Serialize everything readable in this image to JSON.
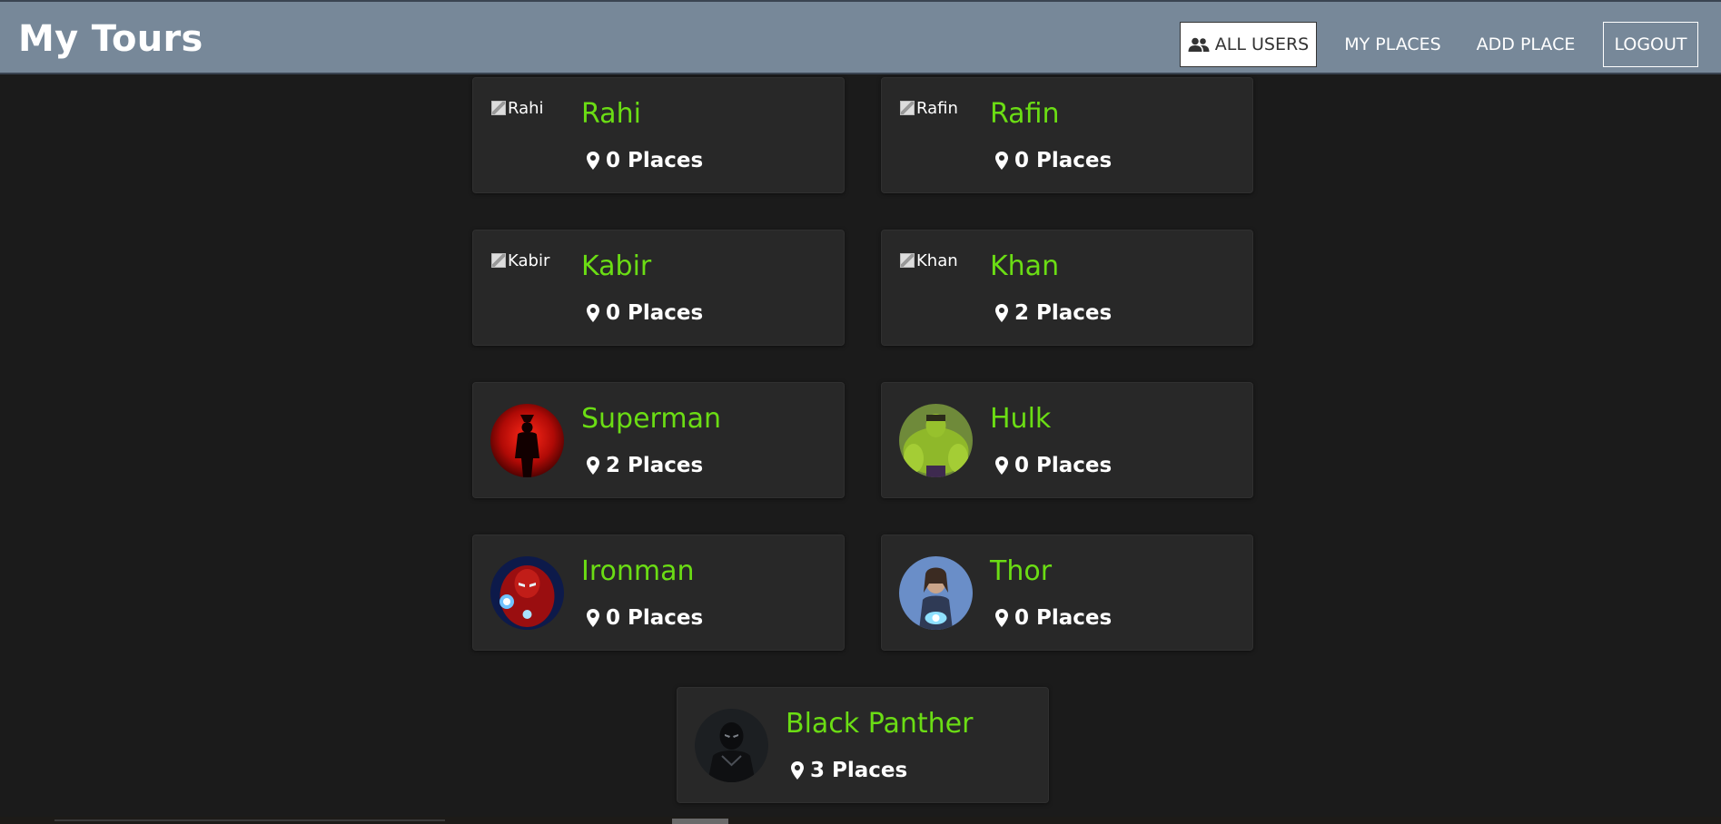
{
  "app": {
    "title": "My Tours"
  },
  "nav": {
    "all_users": "ALL USERS",
    "my_places": "MY PLACES",
    "add_place": "ADD PLACE",
    "logout": "LOGOUT"
  },
  "users": [
    {
      "name": "Rahi",
      "places": "0 Places",
      "alt": "Rahi",
      "avatar": "broken"
    },
    {
      "name": "Rafin",
      "places": "0 Places",
      "alt": "Rafin",
      "avatar": "broken"
    },
    {
      "name": "Kabir",
      "places": "0 Places",
      "alt": "Kabir",
      "avatar": "broken"
    },
    {
      "name": "Khan",
      "places": "2 Places",
      "alt": "Khan",
      "avatar": "broken"
    },
    {
      "name": "Superman",
      "places": "2 Places",
      "avatar": "superman"
    },
    {
      "name": "Hulk",
      "places": "0 Places",
      "avatar": "hulk"
    },
    {
      "name": "Ironman",
      "places": "0 Places",
      "avatar": "ironman"
    },
    {
      "name": "Thor",
      "places": "0 Places",
      "avatar": "thor"
    },
    {
      "name": "Black Panther",
      "places": "3 Places",
      "avatar": "black-panther"
    }
  ],
  "colors": {
    "header": "#778899",
    "background": "#1b1b1b",
    "card": "#282828",
    "name": "#6bdd14"
  }
}
